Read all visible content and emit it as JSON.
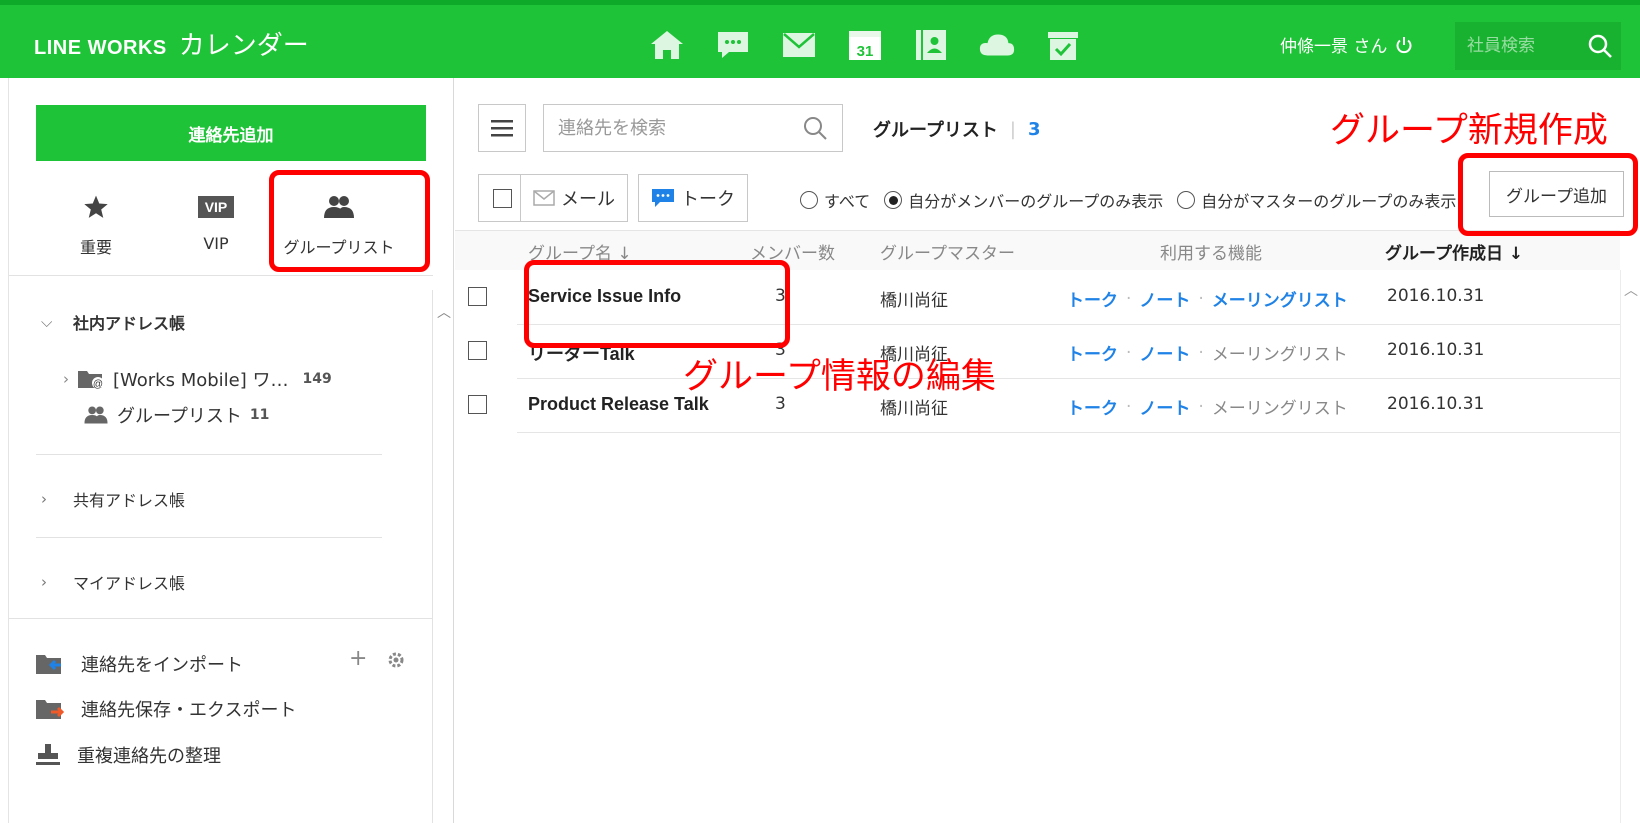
{
  "header": {
    "brand": "LINE WORKS",
    "app_name": "カレンダー",
    "calendar_day": "31",
    "user_label": "仲條一景 さん",
    "emp_search_placeholder": "社員検索",
    "icons": [
      "home-icon",
      "talk-icon",
      "mail-icon",
      "calendar-icon",
      "contacts-icon",
      "drive-icon",
      "task-icon"
    ]
  },
  "sidebar": {
    "add_contact": "連絡先追加",
    "quick": {
      "important": "重要",
      "vip_badge": "VIP",
      "vip": "VIP",
      "group_list": "グループリスト"
    },
    "company_book": "社内アドレス帳",
    "company_org": "[Works Mobile] ワ…",
    "company_org_count": "149",
    "company_groups": "グループリスト",
    "company_groups_count": "11",
    "shared_book": "共有アドレス帳",
    "my_book": "マイアドレス帳",
    "import": "連絡先をインポート",
    "export": "連絡先保存・エクスポート",
    "dedupe": "重複連絡先の整理"
  },
  "main": {
    "search_placeholder": "連絡先を検索",
    "list_title": "グループリスト",
    "list_count": "3",
    "mail_btn": "メール",
    "talk_btn": "トーク",
    "filter_all": "すべて",
    "filter_member": "自分がメンバーのグループのみ表示",
    "filter_master": "自分がマスターのグループのみ表示",
    "add_group": "グループ追加",
    "columns": {
      "name": "グループ名",
      "members": "メンバー数",
      "master": "グループマスター",
      "features": "利用する機能",
      "created": "グループ作成日"
    },
    "rows": [
      {
        "name": "Service Issue Info",
        "members": "3",
        "master": "橋川尚征",
        "talk": "トーク",
        "note": "ノート",
        "mailing": "メーリングリスト",
        "date": "2016.10.31"
      },
      {
        "name": "リーダーTalk",
        "members": "3",
        "master": "橋川尚征",
        "talk": "トーク",
        "note": "ノート",
        "mailing": "メーリングリスト",
        "date": "2016.10.31"
      },
      {
        "name": "Product Release Talk",
        "members": "3",
        "master": "橋川尚征",
        "talk": "トーク",
        "note": "ノート",
        "mailing": "メーリングリスト",
        "date": "2016.10.31"
      }
    ],
    "filter_selected": "member"
  },
  "annotations": {
    "new_group": "グループ新規作成",
    "edit_group": "グループ情報の編集",
    "color": "#ff0000"
  },
  "colors": {
    "brand_green": "#1ec337",
    "link_blue": "#1e82e6"
  }
}
